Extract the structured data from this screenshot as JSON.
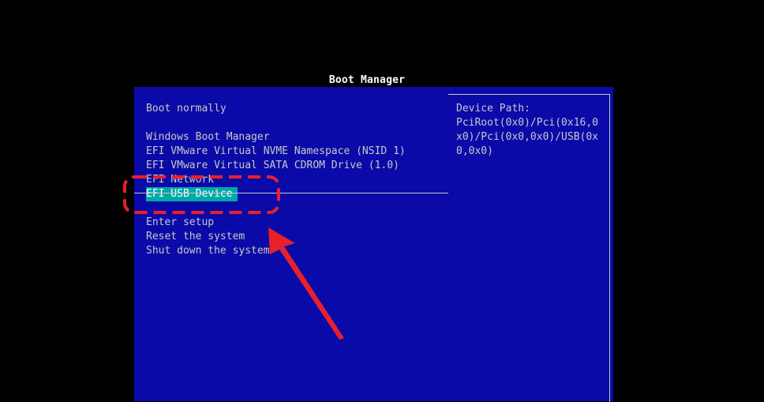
{
  "window": {
    "title": "Boot Manager"
  },
  "menu": {
    "items": [
      {
        "label": "Boot normally"
      },
      {
        "label": "Windows Boot Manager"
      },
      {
        "label": "EFI VMware Virtual NVME Namespace (NSID 1)"
      },
      {
        "label": "EFI VMware Virtual SATA CDROM Drive (1.0)"
      },
      {
        "label": "EFI Network"
      },
      {
        "label": "EFI USB Device",
        "selected": true
      },
      {
        "label": "Enter setup"
      },
      {
        "label": "Reset the system"
      },
      {
        "label": "Shut down the system"
      }
    ]
  },
  "info": {
    "heading": "Device Path:",
    "value": "PciRoot(0x0)/Pci(0x16,0x0)/Pci(0x0,0x0)/USB(0x0,0x0)"
  },
  "colors": {
    "background": "#000000",
    "panel": "#0a0aa8",
    "text": "#c8c8c8",
    "selection": "#00a8a8",
    "annotation": "#e8202a"
  }
}
